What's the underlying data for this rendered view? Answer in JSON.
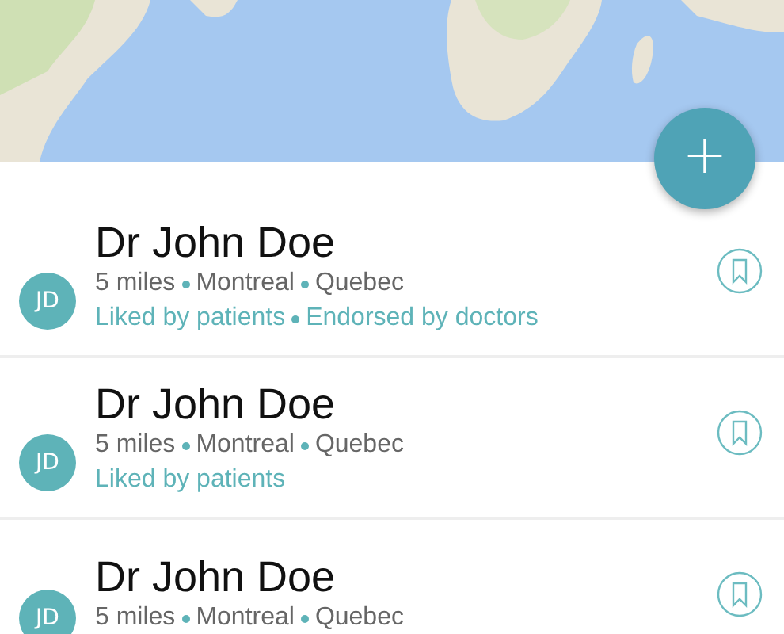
{
  "fab": {
    "label": "+"
  },
  "doctors": [
    {
      "initials": "JD",
      "name": "Dr John Doe",
      "meta": [
        "5 miles",
        "Montreal",
        "Quebec"
      ],
      "tags": [
        "Liked by patients",
        "Endorsed by doctors"
      ]
    },
    {
      "initials": "JD",
      "name": "Dr John Doe",
      "meta": [
        "5 miles",
        "Montreal",
        "Quebec"
      ],
      "tags": [
        "Liked by patients"
      ]
    },
    {
      "initials": "JD",
      "name": "Dr John Doe",
      "meta": [
        "5 miles",
        "Montreal",
        "Quebec"
      ]
    }
  ]
}
